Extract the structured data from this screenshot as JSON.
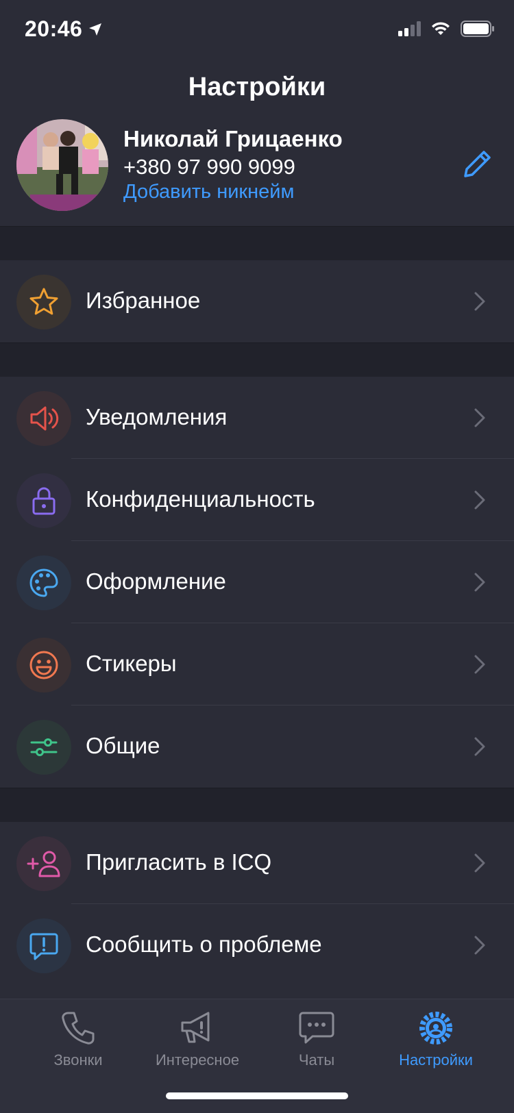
{
  "status_bar": {
    "time": "20:46"
  },
  "header": {
    "title": "Настройки"
  },
  "profile": {
    "name": "Николай Грицаенко",
    "phone": "+380 97 990 9099",
    "add_nickname": "Добавить никнейм"
  },
  "menu": {
    "favorites": {
      "label": "Избранное",
      "icon": "star-icon",
      "color": "#f0a032"
    },
    "notifications": {
      "label": "Уведомления",
      "icon": "speaker-icon",
      "color": "#e5534b"
    },
    "privacy": {
      "label": "Конфиденциальность",
      "icon": "lock-icon",
      "color": "#8a6cf0"
    },
    "appearance": {
      "label": "Оформление",
      "icon": "palette-icon",
      "color": "#4aa8f0"
    },
    "stickers": {
      "label": "Стикеры",
      "icon": "smiley-icon",
      "color": "#f07850"
    },
    "general": {
      "label": "Общие",
      "icon": "sliders-icon",
      "color": "#3fc48a"
    },
    "invite": {
      "label": "Пригласить в ICQ",
      "icon": "add-user-icon",
      "color": "#e05aa8"
    },
    "report": {
      "label": "Сообщить о проблеме",
      "icon": "report-bubble-icon",
      "color": "#4aa8f0"
    }
  },
  "tabbar": {
    "calls": "Звонки",
    "discover": "Интересное",
    "chats": "Чаты",
    "settings": "Настройки"
  },
  "colors": {
    "background": "#2b2c37",
    "section_gap": "#21222b",
    "accent": "#3f9bff",
    "chevron": "#6b6c78"
  }
}
